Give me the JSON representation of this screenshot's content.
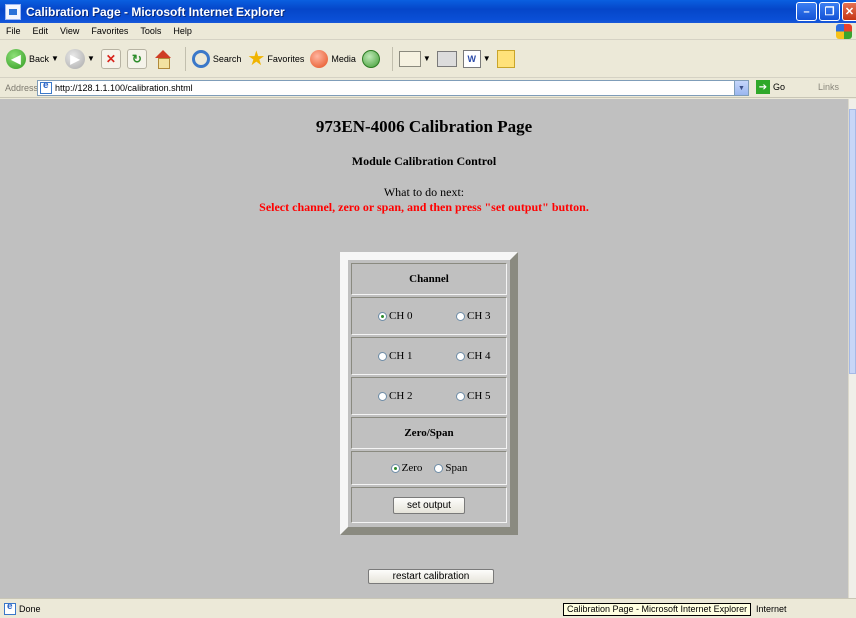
{
  "window": {
    "title": "Calibration Page - Microsoft Internet Explorer"
  },
  "menu": [
    "File",
    "Edit",
    "View",
    "Favorites",
    "Tools",
    "Help"
  ],
  "toolbar": {
    "back_label": "Back",
    "search_label": "Search",
    "favorites_label": "Favorites",
    "media_label": "Media",
    "word_label": "W"
  },
  "address": {
    "label": "Address",
    "url": "http://128.1.1.100/calibration.shtml",
    "go_label": "Go",
    "links_label": "Links"
  },
  "page": {
    "title": "973EN-4006 Calibration Page",
    "subtitle": "Module Calibration Control",
    "what_next": "What to do next:",
    "instruction": "Select channel, zero or span, and then press \"set output\" button.",
    "channel_header": "Channel",
    "channels": [
      "CH 0",
      "CH 1",
      "CH 2",
      "CH 3",
      "CH 4",
      "CH 5"
    ],
    "selected_channel": "CH 0",
    "zerospan_header": "Zero/Span",
    "zero_label": "Zero",
    "span_label": "Span",
    "selected_mode": "Zero",
    "set_output_label": "set output",
    "restart_label": "restart calibration"
  },
  "status": {
    "text": "Done",
    "tooltip": "Calibration Page - Microsoft Internet Explorer",
    "zone": "Internet"
  }
}
